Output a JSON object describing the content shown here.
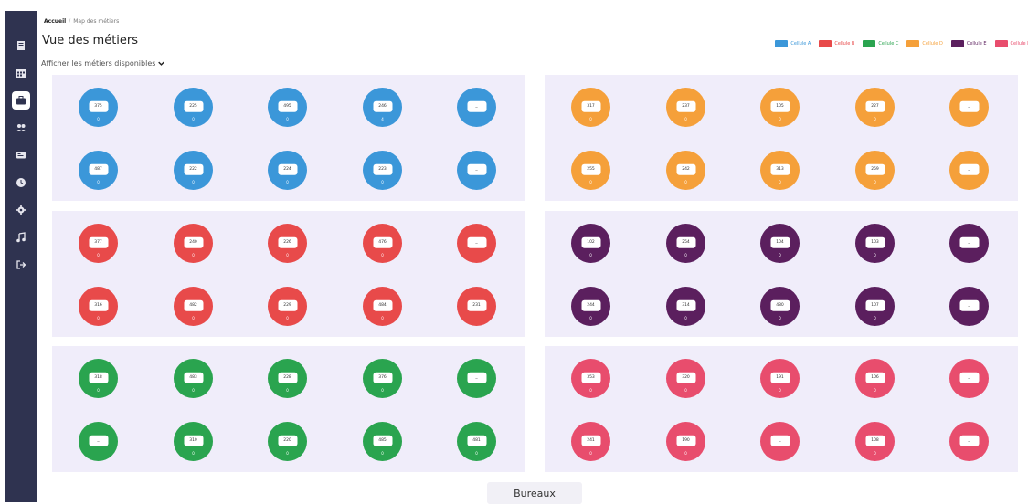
{
  "breadcrumb": {
    "home": "Accueil",
    "separator": "/",
    "current": "Map des métiers"
  },
  "page_title": "Vue des métiers",
  "toggle_label": "Afficher les métiers disponibles",
  "legend": [
    {
      "label": "Cellule A",
      "color": "#3b97d9"
    },
    {
      "label": "Cellule B",
      "color": "#e84a4a"
    },
    {
      "label": "Cellule C",
      "color": "#2aa44f"
    },
    {
      "label": "Cellule D",
      "color": "#f5a03a"
    },
    {
      "label": "Cellule E",
      "color": "#5b1f5e"
    },
    {
      "label": "Cellule F",
      "color": "#e84d6d"
    }
  ],
  "sidebar_items": [
    "list-icon",
    "calendar-icon",
    "briefcase-icon",
    "users-icon",
    "id-card-icon",
    "clock-icon",
    "gear-icon",
    "music-icon",
    "logout-icon"
  ],
  "cells": [
    {
      "name": "A",
      "color": "#3b97d9",
      "rows": [
        [
          {
            "num": "375",
            "count": "0"
          },
          {
            "num": "225",
            "count": "0"
          },
          {
            "num": "495",
            "count": "0"
          },
          {
            "num": "246",
            "count": "4"
          },
          {
            "num": "_",
            "count": ""
          }
        ],
        [
          {
            "num": "487",
            "count": "0"
          },
          {
            "num": "222",
            "count": "0"
          },
          {
            "num": "224",
            "count": "0"
          },
          {
            "num": "223",
            "count": "0"
          },
          {
            "num": "_",
            "count": ""
          }
        ]
      ]
    },
    {
      "name": "D",
      "color": "#f5a03a",
      "rows": [
        [
          {
            "num": "317",
            "count": "0"
          },
          {
            "num": "237",
            "count": "0"
          },
          {
            "num": "105",
            "count": "0"
          },
          {
            "num": "227",
            "count": "0"
          },
          {
            "num": "_",
            "count": ""
          }
        ],
        [
          {
            "num": "255",
            "count": "0"
          },
          {
            "num": "242",
            "count": "0"
          },
          {
            "num": "313",
            "count": "0"
          },
          {
            "num": "259",
            "count": "0"
          },
          {
            "num": "_",
            "count": ""
          }
        ]
      ]
    },
    {
      "name": "B",
      "color": "#e84a4a",
      "rows": [
        [
          {
            "num": "377",
            "count": "0"
          },
          {
            "num": "240",
            "count": "0"
          },
          {
            "num": "226",
            "count": "0"
          },
          {
            "num": "476",
            "count": "0"
          },
          {
            "num": "_",
            "count": ""
          }
        ],
        [
          {
            "num": "316",
            "count": "0"
          },
          {
            "num": "482",
            "count": "0"
          },
          {
            "num": "229",
            "count": "0"
          },
          {
            "num": "484",
            "count": "0"
          },
          {
            "num": "231",
            "count": ""
          }
        ]
      ]
    },
    {
      "name": "E",
      "color": "#5b1f5e",
      "rows": [
        [
          {
            "num": "102",
            "count": "0"
          },
          {
            "num": "254",
            "count": "0"
          },
          {
            "num": "104",
            "count": "0"
          },
          {
            "num": "103",
            "count": "0"
          },
          {
            "num": "_",
            "count": ""
          }
        ],
        [
          {
            "num": "244",
            "count": "0"
          },
          {
            "num": "314",
            "count": "0"
          },
          {
            "num": "480",
            "count": "0"
          },
          {
            "num": "107",
            "count": "0"
          },
          {
            "num": "_",
            "count": ""
          }
        ]
      ]
    },
    {
      "name": "C",
      "color": "#2aa44f",
      "rows": [
        [
          {
            "num": "318",
            "count": "0"
          },
          {
            "num": "483",
            "count": "0"
          },
          {
            "num": "228",
            "count": "0"
          },
          {
            "num": "376",
            "count": "0"
          },
          {
            "num": "_",
            "count": ""
          }
        ],
        [
          {
            "num": "_",
            "count": ""
          },
          {
            "num": "310",
            "count": "0"
          },
          {
            "num": "220",
            "count": "0"
          },
          {
            "num": "485",
            "count": "0"
          },
          {
            "num": "481",
            "count": "0"
          }
        ]
      ]
    },
    {
      "name": "F",
      "color": "#e84d6d",
      "rows": [
        [
          {
            "num": "353",
            "count": "0"
          },
          {
            "num": "320",
            "count": "0"
          },
          {
            "num": "191",
            "count": "0"
          },
          {
            "num": "106",
            "count": "0"
          },
          {
            "num": "_",
            "count": ""
          }
        ],
        [
          {
            "num": "241",
            "count": "0"
          },
          {
            "num": "190",
            "count": "0"
          },
          {
            "num": "_",
            "count": ""
          },
          {
            "num": "108",
            "count": "0"
          },
          {
            "num": "_",
            "count": ""
          }
        ]
      ]
    }
  ],
  "bottom_button": "Bureaux"
}
